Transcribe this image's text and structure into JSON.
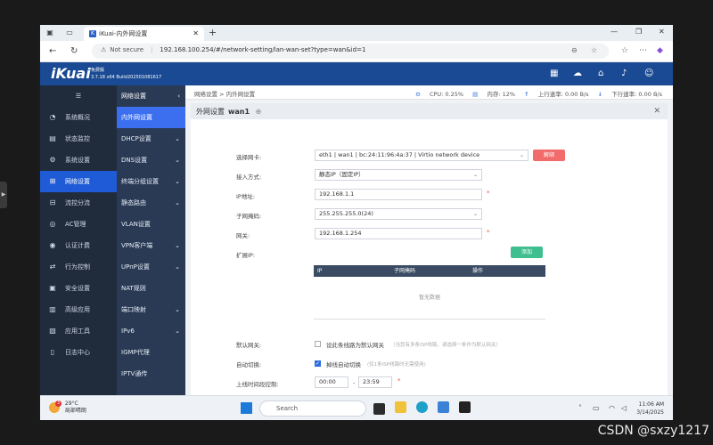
{
  "browser": {
    "tab_title": "iKuai-内外网设置",
    "tab_favicon": "K",
    "new_tab": "+",
    "security_label": "Not secure",
    "url": "192.168.100.254/#/network-setting/lan-wan-set?type=wan&id=1"
  },
  "ikuai": {
    "logo": "iKuai",
    "version_label": "免费版",
    "version": "3.7.18 x64 Build202501081617"
  },
  "sidebar": {
    "items": [
      {
        "label": "系统概况",
        "icon": "dashboard-icon"
      },
      {
        "label": "状态监控",
        "icon": "monitor-icon"
      },
      {
        "label": "系统设置",
        "icon": "gear-icon"
      },
      {
        "label": "网络设置",
        "icon": "network-icon"
      },
      {
        "label": "流控分流",
        "icon": "flow-icon"
      },
      {
        "label": "AC管理",
        "icon": "wifi-icon"
      },
      {
        "label": "认证计费",
        "icon": "auth-icon"
      },
      {
        "label": "行为控制",
        "icon": "behavior-icon"
      },
      {
        "label": "安全设置",
        "icon": "security-icon"
      },
      {
        "label": "高级应用",
        "icon": "advanced-icon"
      },
      {
        "label": "应用工具",
        "icon": "tools-icon"
      },
      {
        "label": "日志中心",
        "icon": "log-icon"
      }
    ]
  },
  "subnav": {
    "items": [
      {
        "label": "网络设置"
      },
      {
        "label": "内外网设置"
      },
      {
        "label": "DHCP设置"
      },
      {
        "label": "DNS设置"
      },
      {
        "label": "终端分组设置"
      },
      {
        "label": "静态路由"
      },
      {
        "label": "VLAN设置"
      },
      {
        "label": "VPN客户端"
      },
      {
        "label": "UPnP设置"
      },
      {
        "label": "NAT规则"
      },
      {
        "label": "端口映射"
      },
      {
        "label": "IPv6"
      },
      {
        "label": "IGMP代理"
      },
      {
        "label": "IPTV通传"
      }
    ]
  },
  "topstrip": {
    "breadcrumb": "网络设置 > 内外网设置",
    "cpu": "CPU: 0.25%",
    "mem": "内存: 12%",
    "up": "上行速率: 0.00 B/s",
    "down": "下行速率: 0.00 B/s"
  },
  "panel": {
    "title": "外网设置",
    "name": "wan1",
    "fields": {
      "nic_label": "选择网卡:",
      "nic_value": "eth1 | wan1 | bc:24:11:96:4a:37 | Virtio network device",
      "unbind": "解绑",
      "access_label": "接入方式:",
      "access_value": "静态IP（固定IP）",
      "ip_label": "IP地址:",
      "ip_value": "192.168.1.1",
      "mask_label": "子网掩码:",
      "mask_value": "255.255.255.0(24)",
      "gw_label": "网关:",
      "gw_value": "192.168.1.254",
      "ext_label": "扩展IP:",
      "add": "添加",
      "col_ip": "IP",
      "col_mask": "子网掩码",
      "col_op": "操作",
      "empty": "暂无数据",
      "default_gw_label": "默认网关:",
      "default_gw_text": "设此条线路为默认网关",
      "default_gw_hint": "（当您有多条ISP线路，请选择一条作为默认网关）",
      "auto_label": "自动切换:",
      "auto_text": "掉线自动切换",
      "auto_hint": "(仅1条ISP线路时无需使用)",
      "time_label": "上线时间段控制:",
      "time_from": "00:00",
      "time_sep": "-",
      "time_to": "23:59"
    }
  },
  "taskbar": {
    "temp": "29°C",
    "weather_text": "局部晴朗",
    "weather_badge": "3",
    "search": "Search",
    "time": "11:06 AM",
    "date": "3/14/2025"
  },
  "watermark": "CSDN @sxzy1217"
}
